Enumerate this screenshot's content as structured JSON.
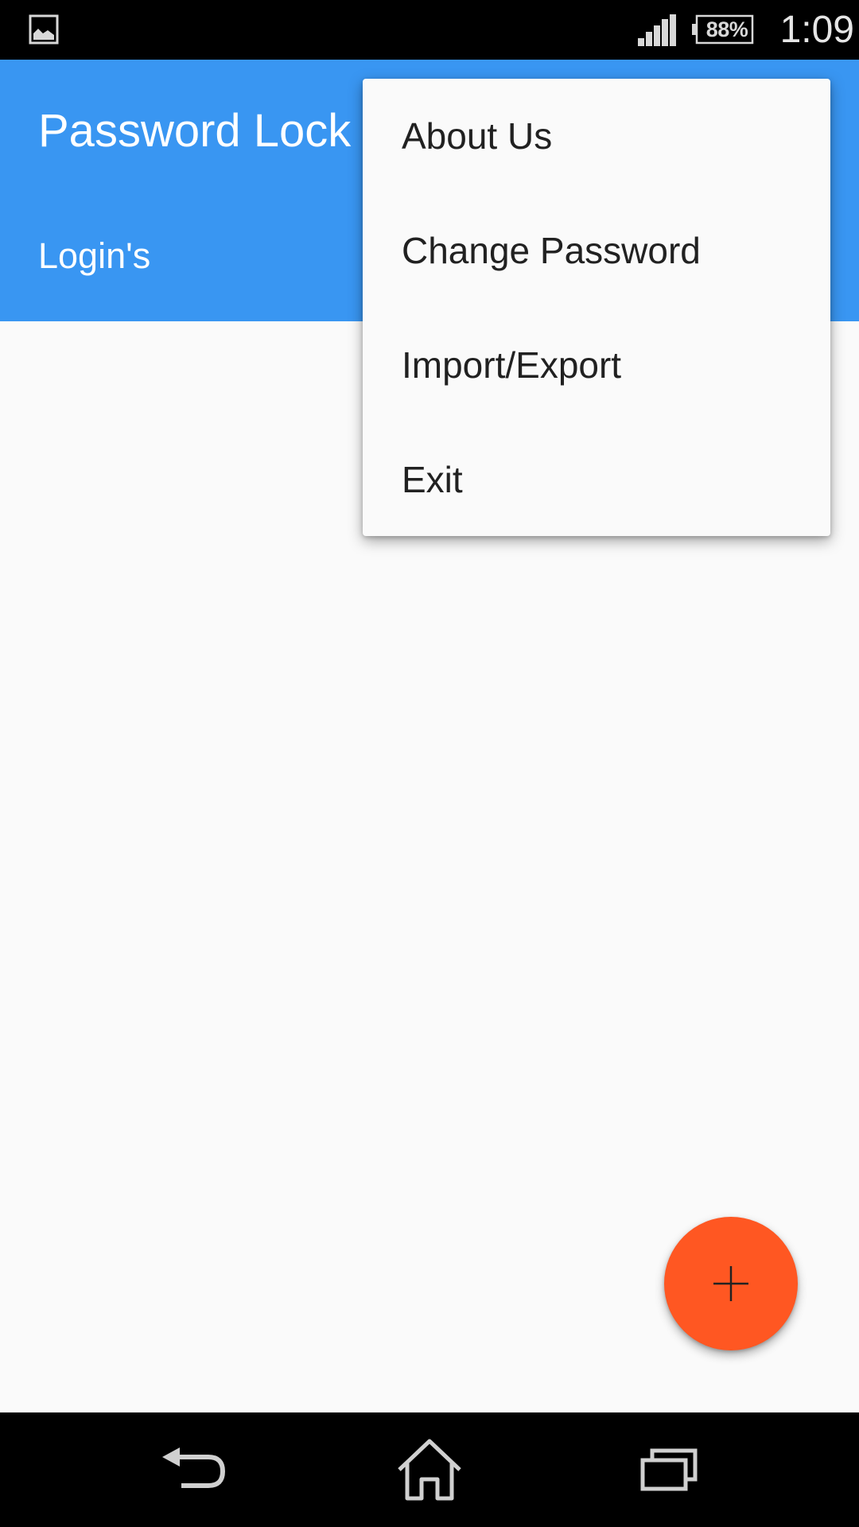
{
  "status_bar": {
    "battery": "88%",
    "time": "1:09",
    "left_icon": "image-icon",
    "signal_icon": "signal-icon"
  },
  "app_bar": {
    "title": "Password Lock",
    "tab": "Login's",
    "color": "#3996F2"
  },
  "overflow_menu": {
    "items": [
      {
        "label": "About Us"
      },
      {
        "label": "Change Password"
      },
      {
        "label": "Import/Export"
      },
      {
        "label": "Exit"
      }
    ]
  },
  "fab": {
    "icon": "plus-icon",
    "color": "#FF5722"
  },
  "nav_bar": {
    "back_icon": "back-icon",
    "home_icon": "home-icon",
    "recents_icon": "recents-icon"
  }
}
